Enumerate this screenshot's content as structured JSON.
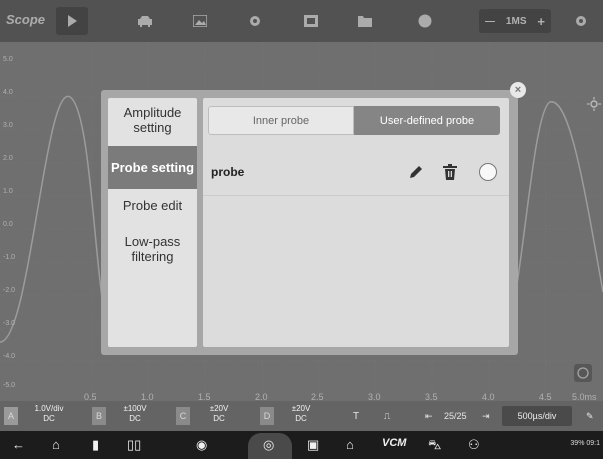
{
  "app": {
    "logo": "Scope"
  },
  "toolbar": {
    "timebase_minus": "—",
    "timebase_value": "1MS",
    "timebase_plus": "+"
  },
  "plot": {
    "y_labels": [
      "5.0",
      "4.0",
      "3.0",
      "2.0",
      "1.0",
      "0.0",
      "-1.0",
      "-2.0",
      "-3.0",
      "-4.0",
      "-5.0"
    ],
    "x_labels": [
      "0.5",
      "1.0",
      "1.5",
      "2.0",
      "2.5",
      "3.0",
      "3.5",
      "4.0",
      "4.5",
      "5.0ms"
    ]
  },
  "dialog": {
    "menu": [
      {
        "label": "Amplitude setting",
        "active": false
      },
      {
        "label": "Probe setting",
        "active": true
      },
      {
        "label": "Probe edit",
        "active": false
      },
      {
        "label": "Low-pass filtering",
        "active": false
      }
    ],
    "tabs": {
      "inner": "Inner probe",
      "user": "User-defined probe"
    },
    "probe": {
      "name": "probe"
    },
    "close_symbol": "×"
  },
  "channels": [
    {
      "letter": "A",
      "scale": "1.0V/div",
      "coupling": "DC"
    },
    {
      "letter": "B",
      "scale": "±100V",
      "coupling": "DC"
    },
    {
      "letter": "C",
      "scale": "±20V",
      "coupling": "DC"
    },
    {
      "letter": "D",
      "scale": "±20V",
      "coupling": "DC"
    }
  ],
  "chbar": {
    "trigger": "T",
    "pulse": "⎍",
    "page": "25/25",
    "time_div": "500µs/div"
  },
  "status": {
    "text": "39% 09:1"
  },
  "colors": {
    "accent_active": "#7b7b7b",
    "dialog_bg": "#a7a7a7",
    "waveform": "#cfcfcf"
  }
}
